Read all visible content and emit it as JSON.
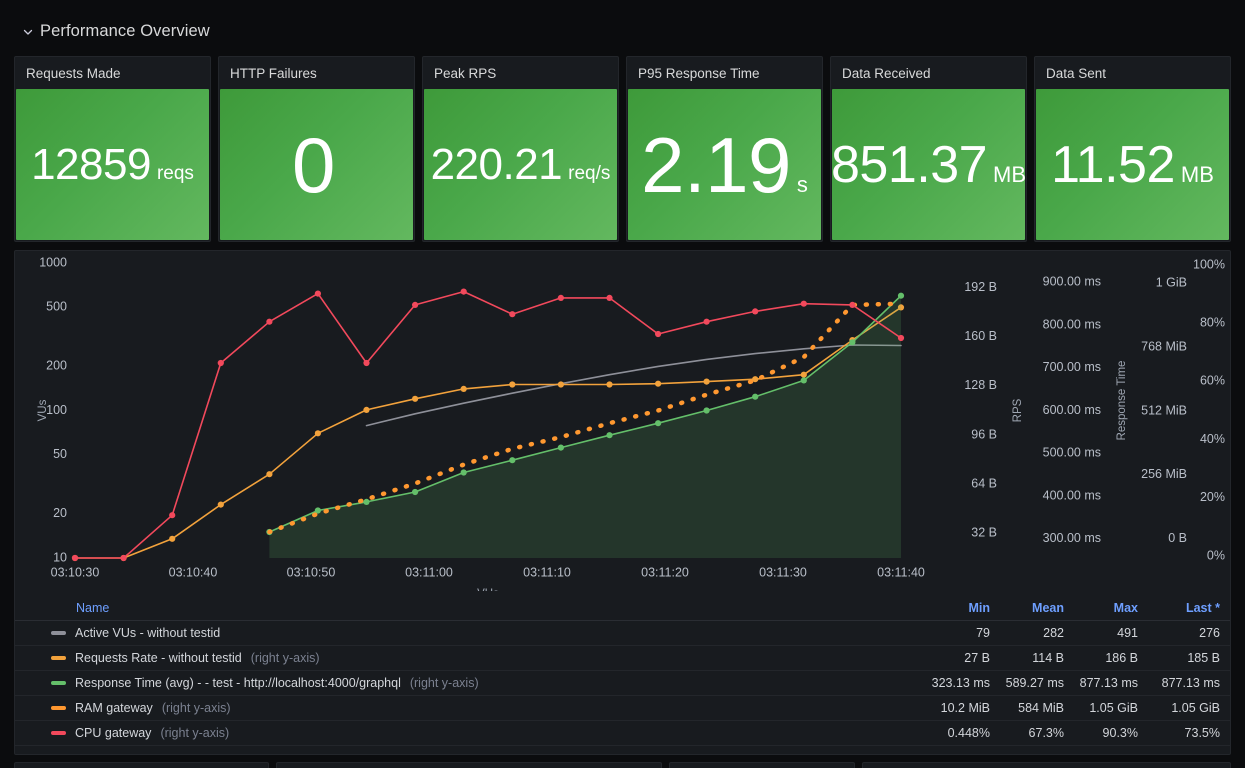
{
  "row": {
    "title": "Performance Overview",
    "collapse_icon": "chevron-down-icon",
    "expanded": true
  },
  "stats": [
    {
      "title": "Requests Made",
      "value": "12859",
      "unit": "reqs",
      "size": "normal",
      "color": "#4aa84a"
    },
    {
      "title": "HTTP Failures",
      "value": "0",
      "unit": "",
      "size": "big",
      "color": "#4aa84a"
    },
    {
      "title": "Peak RPS",
      "value": "220.21",
      "unit": "req/s",
      "size": "normal",
      "color": "#4aa84a"
    },
    {
      "title": "P95 Response Time",
      "value": "2.19",
      "unit": "s",
      "size": "mid",
      "color": "#4aa84a"
    },
    {
      "title": "Data Received",
      "value": "851.37",
      "unit": "MB",
      "size": "mid",
      "color": "#4aa84a"
    },
    {
      "title": "Data Sent",
      "value": "11.52",
      "unit": "MB",
      "size": "mid",
      "color": "#4aa84a"
    }
  ],
  "chart_data": {
    "type": "line",
    "title": "",
    "xlabel": "VUs",
    "x_tick_labels": [
      "03:10:30",
      "03:10:40",
      "03:10:50",
      "03:11:00",
      "03:11:10",
      "03:11:20",
      "03:11:30",
      "03:11:40"
    ],
    "grid": false,
    "legend_position": "bottom-table",
    "axes": [
      {
        "id": "vus",
        "side": "left",
        "label": "VUs",
        "scale": "log",
        "ticks": [
          "10",
          "20",
          "50",
          "100",
          "200",
          "500",
          "1000"
        ],
        "tick_values": [
          10,
          20,
          50,
          100,
          200,
          500,
          1000
        ]
      },
      {
        "id": "bytes",
        "side": "right",
        "label": "",
        "scale": "linear",
        "ticks": [
          "32 B",
          "64 B",
          "96 B",
          "128 B",
          "160 B",
          "192 B"
        ],
        "tick_values": [
          32,
          64,
          96,
          128,
          160,
          192
        ]
      },
      {
        "id": "rps",
        "side": "right",
        "label": "RPS",
        "scale": "linear",
        "ticks": [
          "300.00 ms",
          "400.00 ms",
          "500.00 ms",
          "600.00 ms",
          "700.00 ms",
          "800.00 ms",
          "900.00 ms"
        ],
        "tick_values": [
          300,
          400,
          500,
          600,
          700,
          800,
          900
        ]
      },
      {
        "id": "mem",
        "side": "right",
        "label": "Response Time",
        "scale": "linear",
        "ticks": [
          "0 B",
          "256 MiB",
          "512 MiB",
          "768 MiB",
          "1 GiB"
        ],
        "tick_values": [
          0,
          256,
          512,
          768,
          1024
        ]
      },
      {
        "id": "pct",
        "side": "right",
        "label": "",
        "scale": "linear",
        "ticks": [
          "0%",
          "20%",
          "40%",
          "60%",
          "80%",
          "100%"
        ],
        "tick_values": [
          0,
          20,
          40,
          60,
          80,
          100
        ]
      }
    ],
    "series": [
      {
        "name": "Active VUs - without testid",
        "color": "#8e9099",
        "style": "solid-nomarker",
        "x": [
          6,
          7,
          8,
          9,
          10,
          11,
          12,
          13,
          14,
          15,
          16,
          17
        ],
        "values": [
          79,
          95,
          112,
          131,
          152,
          175,
          199,
          222,
          243,
          262,
          278,
          276
        ]
      },
      {
        "name": "Requests Rate - without testid",
        "color": "#f2a23c",
        "style": "solid",
        "x": [
          0,
          1,
          2,
          3,
          4,
          5,
          6,
          7,
          8,
          9,
          10,
          11,
          12,
          13,
          14,
          15,
          16,
          17
        ],
        "values": [
          10,
          10,
          13.5,
          23,
          37,
          70,
          101,
          120,
          140,
          150,
          150,
          150,
          152,
          157,
          163,
          175,
          300,
          500
        ]
      },
      {
        "name": "Response Time (avg) - - test - http://localhost:4000/graphql",
        "color": "#64bf6a",
        "style": "area",
        "x": [
          4,
          5,
          6,
          7,
          8,
          9,
          10,
          11,
          12,
          13,
          14,
          15,
          16,
          17
        ],
        "values": [
          15,
          21,
          24,
          28,
          38,
          46,
          56,
          68,
          82,
          100,
          124,
          160,
          290,
          600
        ]
      },
      {
        "name": "RAM gateway",
        "color": "#ff9830",
        "style": "dashed",
        "x": [
          4,
          5,
          6,
          7,
          8,
          9,
          10,
          11,
          12,
          13,
          14,
          15,
          16,
          17
        ],
        "values": [
          15,
          20,
          25,
          32,
          43,
          55,
          66,
          82,
          100,
          128,
          160,
          230,
          520,
          530
        ]
      },
      {
        "name": "CPU gateway",
        "color": "#f2495c",
        "style": "solid",
        "x": [
          0,
          1,
          2,
          3,
          4,
          5,
          6,
          7,
          8,
          9,
          10,
          11,
          12,
          13,
          14,
          15,
          16,
          17
        ],
        "values": [
          10,
          10,
          19.5,
          210,
          400,
          620,
          210,
          520,
          640,
          450,
          580,
          580,
          330,
          400,
          470,
          530,
          520,
          310
        ]
      }
    ]
  },
  "legend": {
    "columns": [
      "Name",
      "Min",
      "Mean",
      "Max",
      "Last *"
    ],
    "rows": [
      {
        "color": "#8e9099",
        "label": "Active VUs - without testid",
        "sub": "",
        "min": "79",
        "mean": "282",
        "max": "491",
        "last": "276"
      },
      {
        "color": "#f2a23c",
        "label": "Requests Rate - without testid",
        "sub": "(right y-axis)",
        "min": "27 B",
        "mean": "114 B",
        "max": "186 B",
        "last": "185 B"
      },
      {
        "color": "#64bf6a",
        "label": "Response Time (avg) - - test - http://localhost:4000/graphql",
        "sub": "(right y-axis)",
        "min": "323.13 ms",
        "mean": "589.27 ms",
        "max": "877.13 ms",
        "last": "877.13 ms"
      },
      {
        "color": "#ff9830",
        "label": "RAM gateway",
        "sub": "(right y-axis)",
        "min": "10.2 MiB",
        "mean": "584 MiB",
        "max": "1.05 GiB",
        "last": "1.05 GiB"
      },
      {
        "color": "#f2495c",
        "label": "CPU gateway",
        "sub": "(right y-axis)",
        "min": "0.448%",
        "mean": "67.3%",
        "max": "90.3%",
        "last": "73.5%"
      }
    ]
  },
  "colors": {
    "page_background": "#0b0c0e",
    "panel_background": "#181b1f",
    "panel_border": "#23262b",
    "accent_blue": "#6e9fff",
    "stat_green": "#4aa84a"
  }
}
